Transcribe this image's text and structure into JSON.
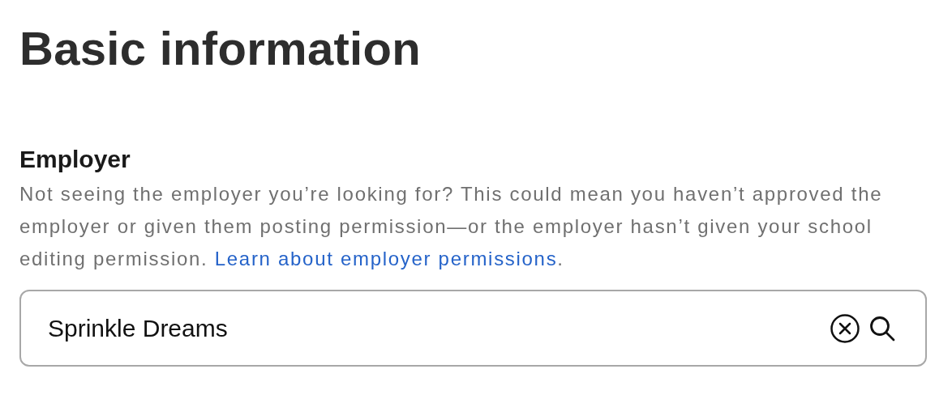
{
  "heading": "Basic information",
  "employer": {
    "label": "Employer",
    "help": {
      "text": "Not seeing the employer you’re looking for? This could mean you haven’t approved the employer or given them posting permission—or the employer hasn’t given your school editing permission. ",
      "link": "Learn about employer permissions",
      "after": "."
    },
    "field": {
      "value": "Sprinkle Dreams"
    }
  }
}
